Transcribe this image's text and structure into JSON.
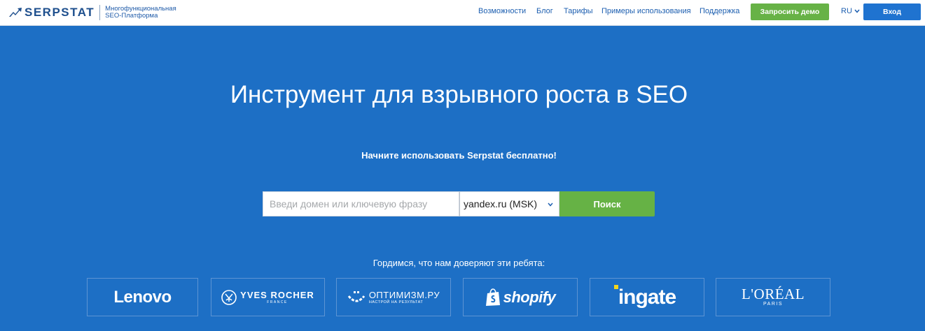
{
  "header": {
    "logo_text": "SERPSTAT",
    "tagline": "Многофункциональная SEO-Платформа",
    "nav": [
      {
        "label": "Возможности"
      },
      {
        "label": "Блог"
      },
      {
        "label": "Тарифы"
      },
      {
        "label": "Примеры использования"
      },
      {
        "label": "Поддержка"
      }
    ],
    "demo_label": "Запросить демо",
    "lang": "RU",
    "login_label": "Вход"
  },
  "hero": {
    "title": "Инструмент для взрывного роста в SEO",
    "subtitle": "Начните использовать Serpstat бесплатно!",
    "search": {
      "placeholder": "Введи домен или ключевую фразу",
      "value": "",
      "engine": "yandex.ru (MSK)",
      "button_label": "Поиск"
    },
    "trust_text": "Гордимся, что нам доверяют эти ребята:"
  },
  "clients": [
    {
      "name": "Lenovo",
      "logo": "lenovo-logo"
    },
    {
      "name": "YVES ROCHER",
      "sub": "FRANCE",
      "logo": "yves-rocher-logo"
    },
    {
      "name": "ОПТИМИЗМ.РУ",
      "sub": "НАСТРОЙ НА РЕЗУЛЬТАТ",
      "logo": "optimizm-logo"
    },
    {
      "name": "shopify",
      "logo": "shopify-logo"
    },
    {
      "name": "ingate",
      "logo": "ingate-logo"
    },
    {
      "name": "L'ORÉAL",
      "sub": "PARIS",
      "logo": "loreal-logo"
    }
  ],
  "colors": {
    "hero_bg": "#1d6fc5",
    "demo_green": "#67b246",
    "login_blue": "#1f73d0",
    "link_blue": "#1d5fb0"
  }
}
